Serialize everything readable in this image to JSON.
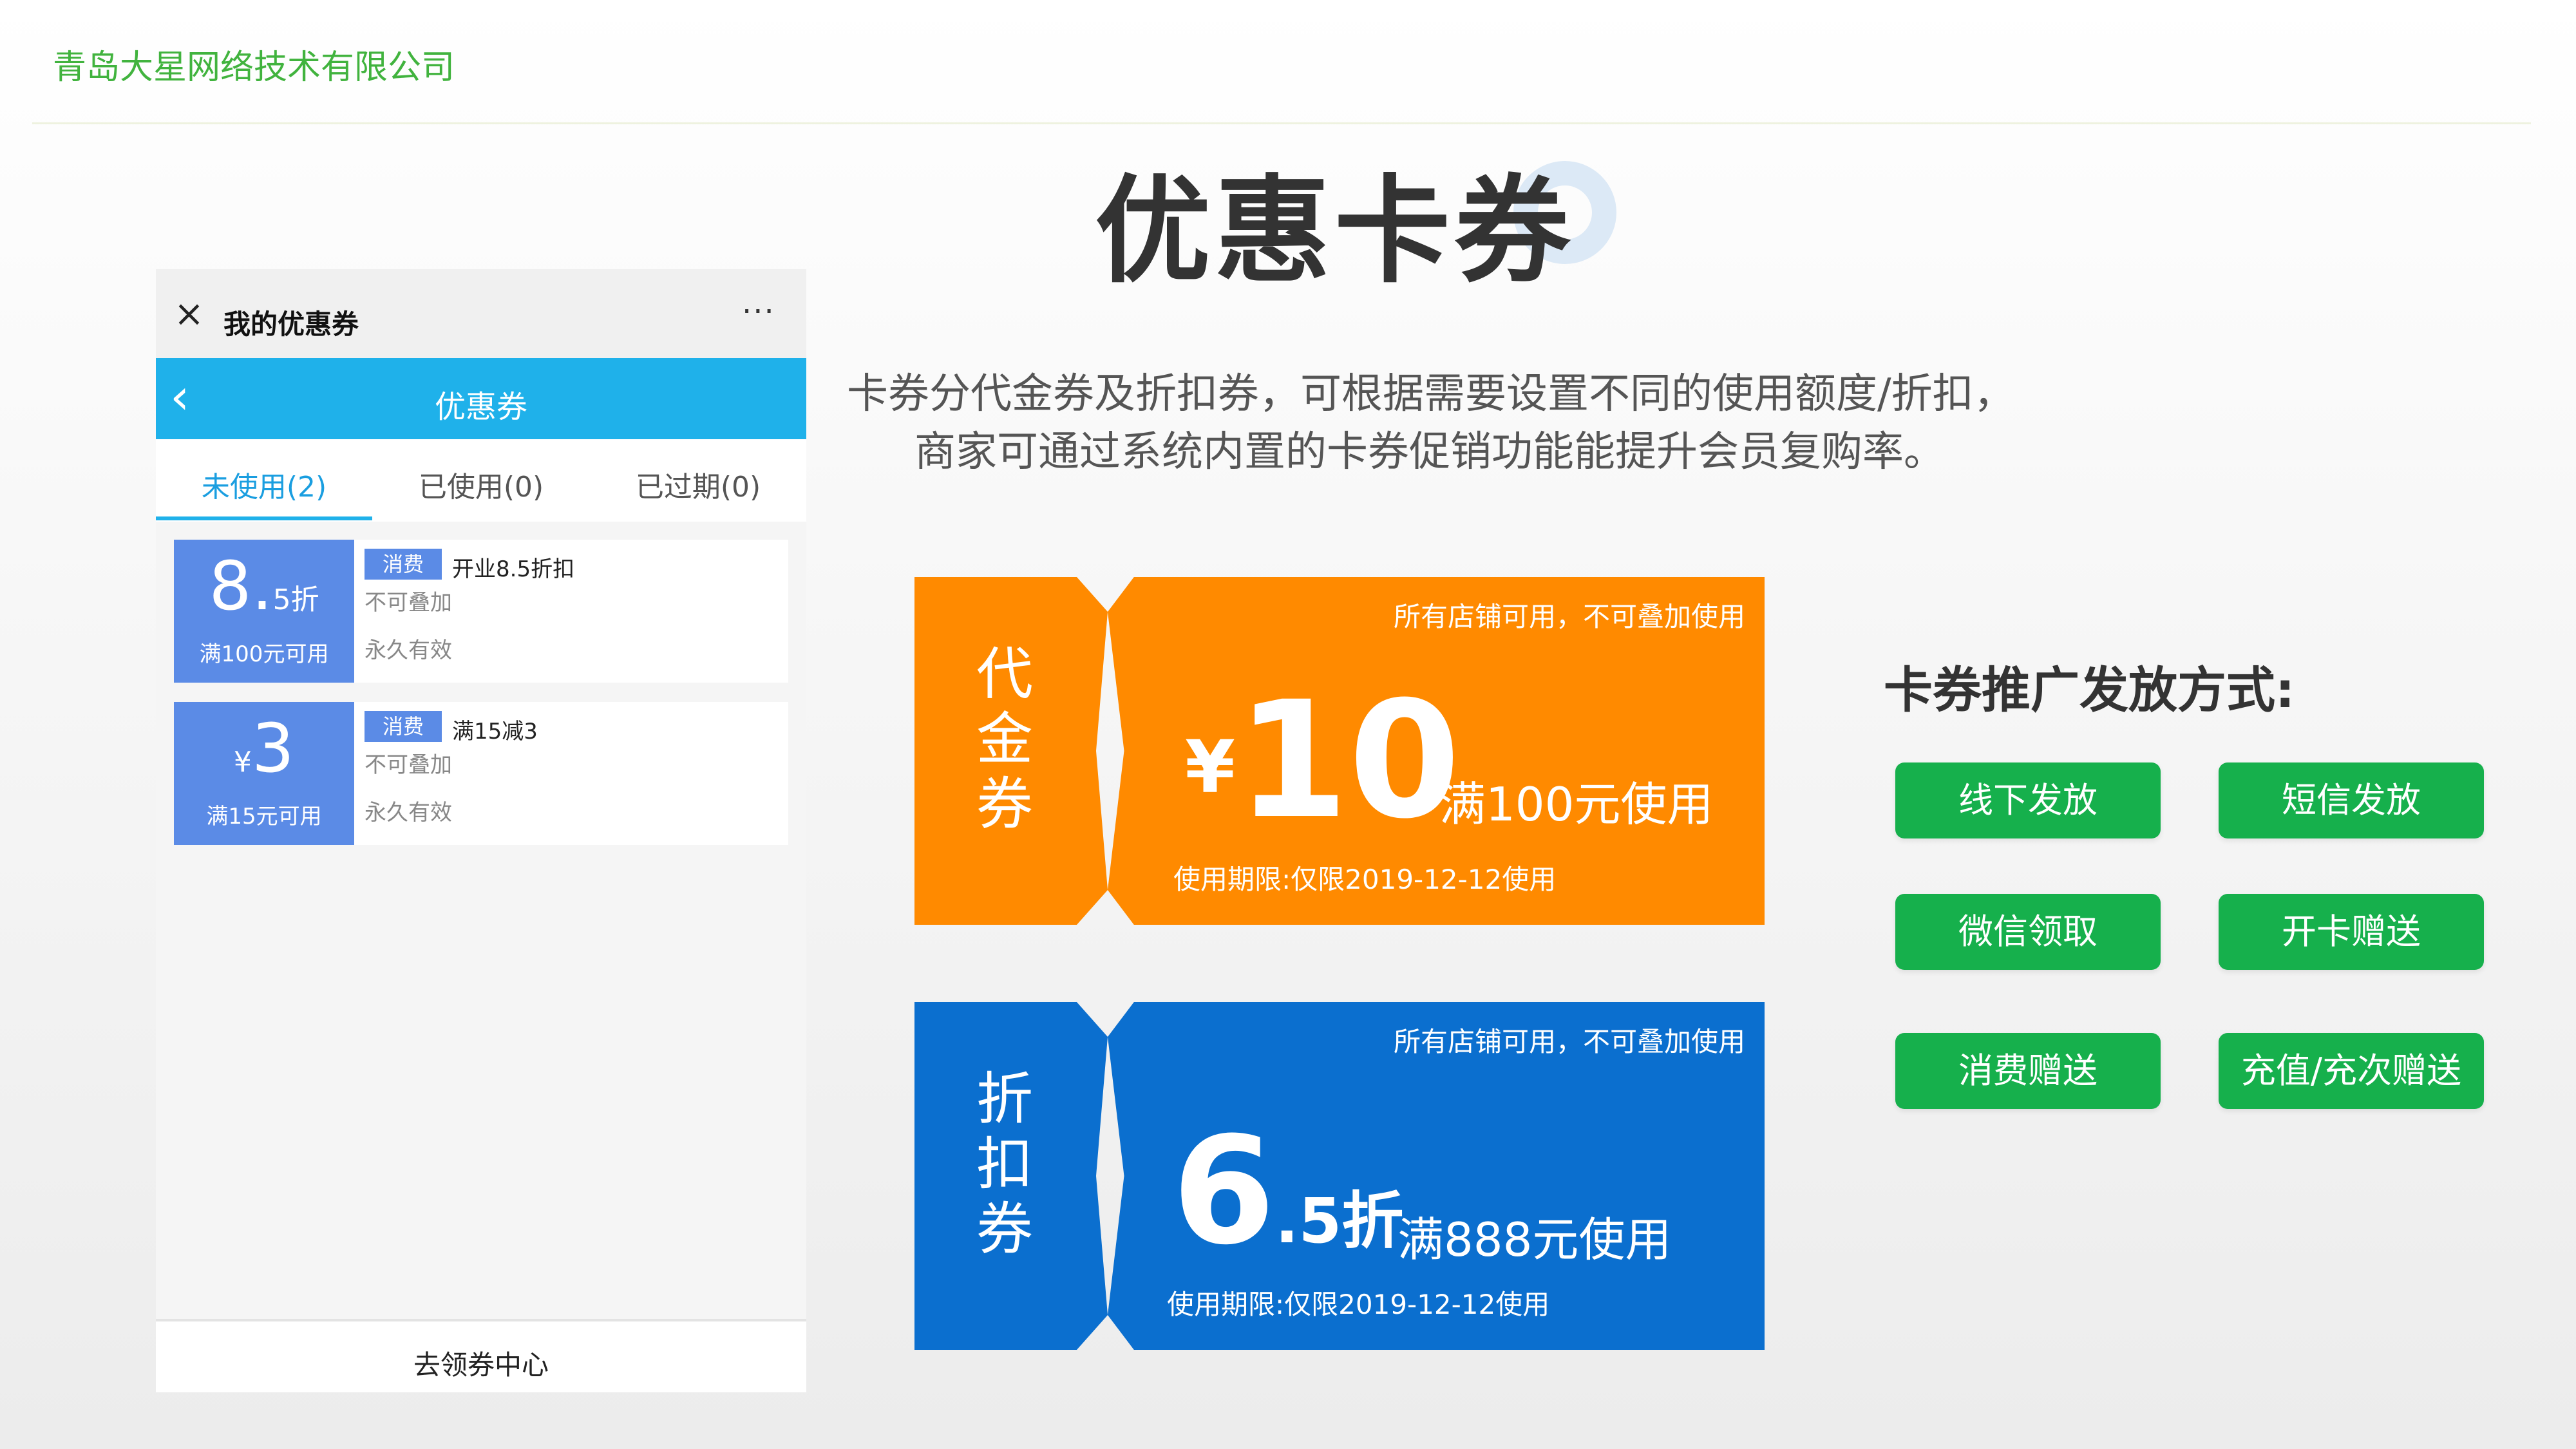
{
  "header": {
    "company": "青岛大星网络技术有限公司"
  },
  "page": {
    "title": "优惠卡券",
    "desc_line1": "卡券分代金券及折扣券，可根据需要设置不同的使用额度/折扣，",
    "desc_line2": "商家可通过系统内置的卡券促销功能能提升会员复购率。"
  },
  "phone": {
    "titlebar": {
      "title": "我的优惠券",
      "close_icon": "×",
      "more_icon": "···"
    },
    "nav": {
      "back_icon": "‹",
      "title": "优惠券"
    },
    "tabs": [
      {
        "label": "未使用(2)",
        "active": true
      },
      {
        "label": "已使用(0)"
      },
      {
        "label": "已过期(0)"
      }
    ],
    "coupons": [
      {
        "main": "8.",
        "small": "5折",
        "condition": "满100元可用",
        "tag": "消费",
        "name": "开业8.5折扣",
        "line2": "不可叠加",
        "line3": "永久有效"
      },
      {
        "currency": "¥",
        "main": "3",
        "condition": "满15元可用",
        "tag": "消费",
        "name": "满15减3",
        "line2": "不可叠加",
        "line3": "永久有效"
      }
    ],
    "bottom_label": "去领券中心"
  },
  "vouchers": {
    "cash": {
      "type_label": "代金券",
      "note": "所有店铺可用，不可叠加使用",
      "currency": "¥",
      "amount": "10",
      "condition": "满100元使用",
      "validity": "使用期限:仅限2019-12-12使用",
      "color": "#ff8a00"
    },
    "discount": {
      "type_label": "折扣券",
      "note": "所有店铺可用，不可叠加使用",
      "amount": "6",
      "amount_small": ".5折",
      "condition": "满888元使用",
      "validity": "使用期限:仅限2019-12-12使用",
      "color": "#0b6fcf"
    }
  },
  "distribution": {
    "title": "卡券推广发放方式:",
    "methods": [
      "线下发放",
      "短信发放",
      "微信领取",
      "开卡赠送",
      "消费赠送",
      "充值/充次赠送"
    ],
    "button_color": "#16b04c"
  }
}
